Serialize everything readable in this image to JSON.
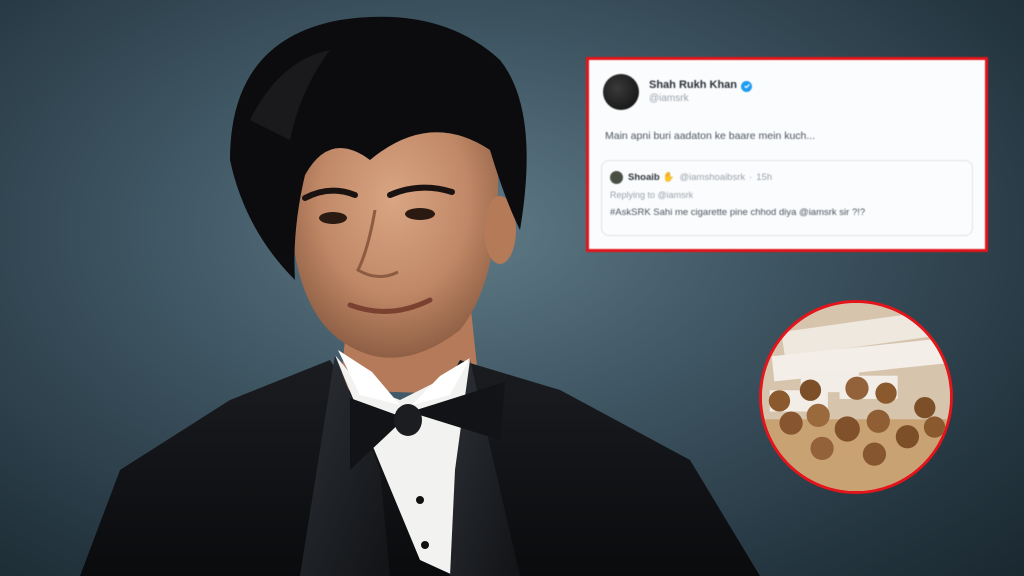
{
  "tweet": {
    "display_name": "Shah Rukh Khan",
    "handle": "@iamsrk",
    "text": "Main apni buri aadaton ke baare mein kuch...",
    "quote": {
      "display_name": "Shoaib",
      "handle": "@iamshoaibsrk",
      "time": "15h",
      "replying_to": "Replying to @iamsrk",
      "text": "#AskSRK Sahi me cigarette pine chhod diya @iamsrk sir ?!?"
    }
  },
  "icons": {
    "verified": "verified-badge-icon",
    "quote_badge": "emoji-icon"
  },
  "colors": {
    "highlight_border": "#e3151a",
    "verified_blue": "#1d9bf0",
    "backdrop": "#3e5562"
  }
}
